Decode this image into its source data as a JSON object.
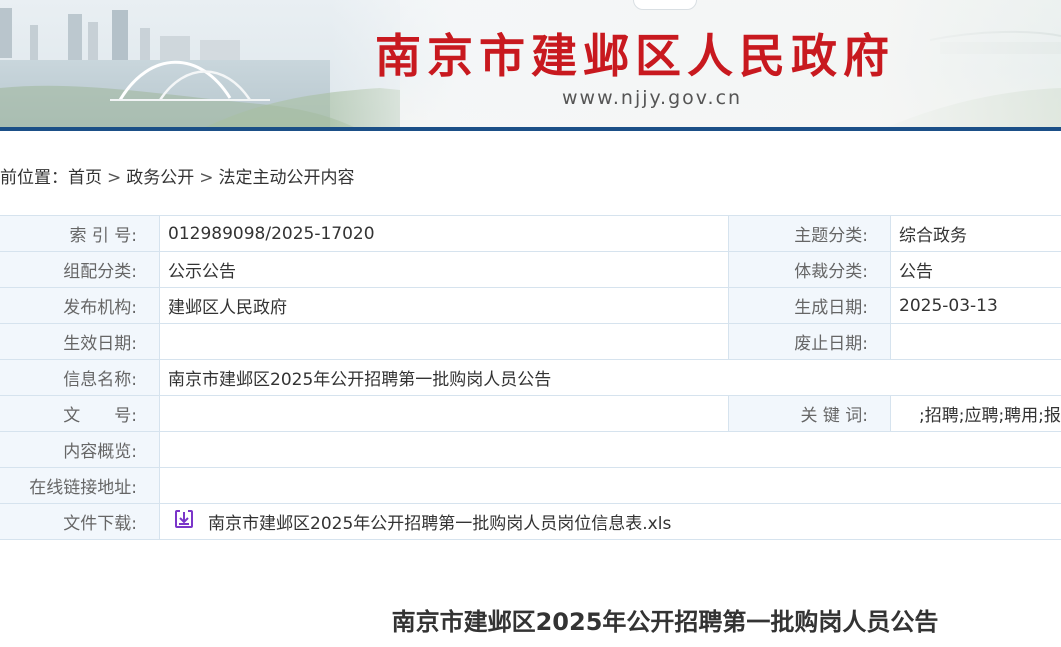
{
  "header": {
    "site_title": "南京市建邺区人民政府",
    "site_url": "www.njjy.gov.cn"
  },
  "breadcrumb": {
    "prefix": "前位置：",
    "items": [
      "首页",
      "政务公开",
      "法定主动公开内容"
    ],
    "separator": ">"
  },
  "info": {
    "index_label": "索 引 号:",
    "index_value": "012989098/2025-17020",
    "topic_label": "主题分类:",
    "topic_value": "综合政务",
    "org_cat_label": "组配分类:",
    "org_cat_value": "公示公告",
    "genre_label": "体裁分类:",
    "genre_value": "公告",
    "publisher_label": "发布机构:",
    "publisher_value": "建邺区人民政府",
    "created_label": "生成日期:",
    "created_value": "2025-03-13",
    "effective_label": "生效日期:",
    "effective_value": "",
    "abolished_label": "废止日期:",
    "abolished_value": "",
    "name_label": "信息名称:",
    "name_value": "南京市建邺区2025年公开招聘第一批购岗人员公告",
    "doc_no_label": "文　　号:",
    "doc_no_value": "",
    "keywords_label": "关 键 词:",
    "keywords_value": ";招聘;应聘;聘用;报",
    "summary_label": "内容概览:",
    "summary_value": "",
    "link_label": "在线链接地址:",
    "link_value": "",
    "download_label": "文件下载:",
    "download_file": "南京市建邺区2025年公开招聘第一批购岗人员岗位信息表.xls"
  },
  "article": {
    "title": "南京市建邺区2025年公开招聘第一批购岗人员公告"
  },
  "colors": {
    "title_red": "#c8191f",
    "banner_line": "#1b4f87",
    "label_bg": "#f2f7fc",
    "border": "#d6e3ee",
    "download_icon": "#7b35c9"
  }
}
